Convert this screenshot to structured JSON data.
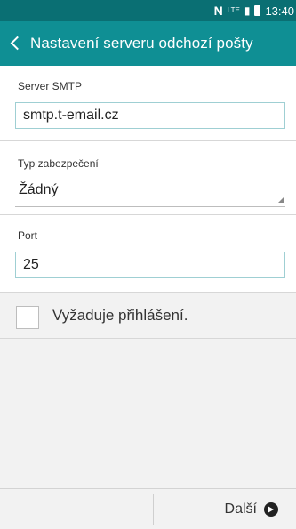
{
  "status_bar": {
    "carrier_icon": "N",
    "lte_icon": "LTE",
    "signal_icon": "signal",
    "battery_icon": "battery",
    "time": "13:40"
  },
  "app_bar": {
    "back_icon": "chevron-left-icon",
    "title": "Nastavení serveru odchozí pošty"
  },
  "form": {
    "smtp": {
      "label": "Server SMTP",
      "value": "smtp.t-email.cz"
    },
    "security": {
      "label": "Typ zabezpečení",
      "value": "Žádný"
    },
    "port": {
      "label": "Port",
      "value": "25"
    },
    "login_required": {
      "label": "Vyžaduje přihlášení.",
      "checked": false
    }
  },
  "bottom_bar": {
    "next_label": "Další",
    "next_icon": "arrow-right-circle-icon"
  }
}
